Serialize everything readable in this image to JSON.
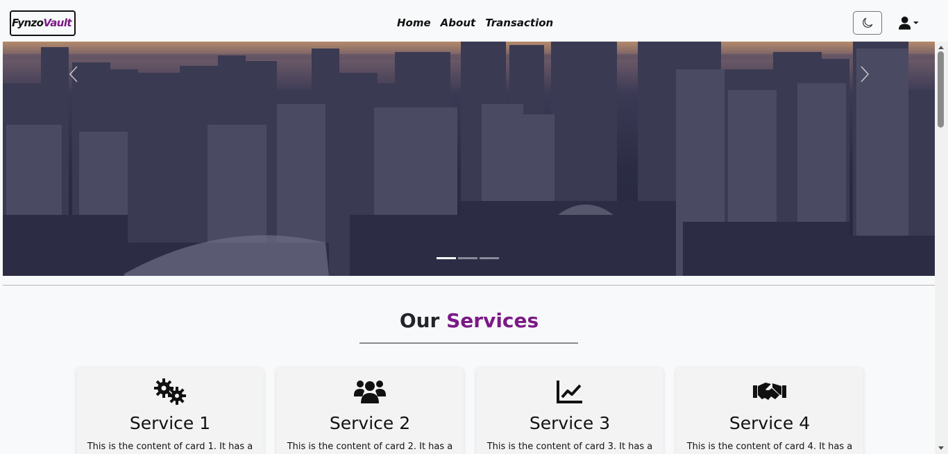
{
  "brand": {
    "part1": "Fynzo",
    "part2": "Vault"
  },
  "nav": {
    "items": [
      "Home",
      "About",
      "Transaction"
    ]
  },
  "theme_toggle": {
    "icon": "moon-icon"
  },
  "user_menu": {
    "icon": "user-icon"
  },
  "carousel": {
    "slides": 3,
    "active_index": 0
  },
  "services": {
    "title_prefix": "Our",
    "title_accent": "Services",
    "cards": [
      {
        "icon": "gears-icon",
        "title": "Service 1",
        "text": "This is the content of card 1. It has a"
      },
      {
        "icon": "users-icon",
        "title": "Service 2",
        "text": "This is the content of card 2. It has a"
      },
      {
        "icon": "chart-line-icon",
        "title": "Service 3",
        "text": "This is the content of card 3. It has a"
      },
      {
        "icon": "handshake-icon",
        "title": "Service 4",
        "text": "This is the content of card 4. It has a"
      }
    ]
  },
  "colors": {
    "accent": "#7b1a86",
    "background": "#f8f9fa"
  }
}
